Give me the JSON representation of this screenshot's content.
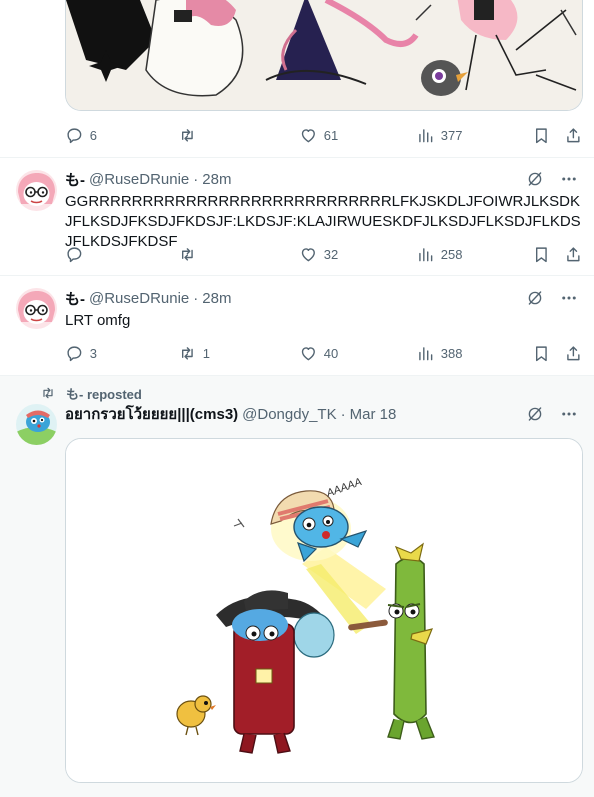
{
  "posts": [
    {
      "comments": "6",
      "reposts": "",
      "likes": "61",
      "views": "377"
    },
    {
      "name": "も-",
      "handle": "@RuseDRunie",
      "dot": "·",
      "time": "28m",
      "text": "GGRRRRRRRRRRRRRRRRRRRRRRRRRRRRLFKJSKDLJFOIWRJLKSDKJFLKSDJFKSDJFKDSJF:LKDSJF:KLAJIRWUESKDFJLKSDJFLKSDJFLKDSJFLKDSJFKDSF",
      "comments": "",
      "reposts": "",
      "likes": "32",
      "views": "258"
    },
    {
      "name": "も-",
      "handle": "@RuseDRunie",
      "dot": "·",
      "time": "28m",
      "text": "LRT omfg",
      "comments": "3",
      "reposts": "1",
      "likes": "40",
      "views": "388"
    },
    {
      "repost_label": "も- reposted",
      "name": "อยากรวยโว้ยยยย|||(cms3)",
      "handle": "@Dongdy_TK",
      "dot": "·",
      "time": "Mar 18"
    }
  ],
  "icons": {
    "reply": "speech-bubble-icon",
    "repost": "repost-arrows-icon",
    "like": "heart-icon",
    "views": "bar-chart-icon",
    "bookmark": "bookmark-icon",
    "share": "share-upload-icon",
    "grok": "grok-slash-circle-icon",
    "more": "more-dots-icon"
  },
  "colors": {
    "text": "#0f1419",
    "muted": "#536471",
    "border": "#eff3f4",
    "highlight_bg": "#f7f9f9"
  }
}
